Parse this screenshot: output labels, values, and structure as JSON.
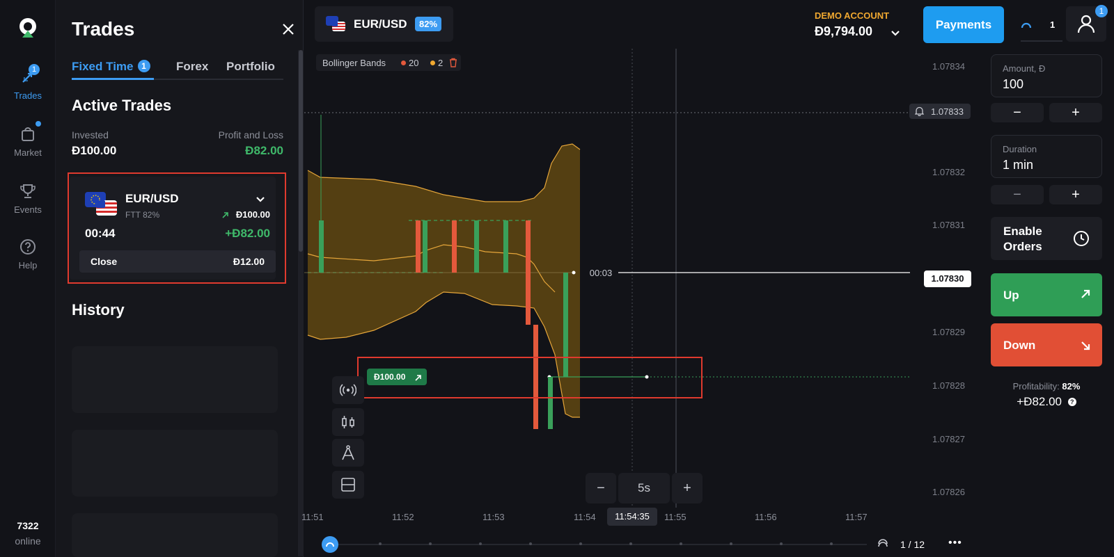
{
  "nav": {
    "trades": {
      "label": "Trades",
      "badge": "1"
    },
    "market": {
      "label": "Market"
    },
    "events": {
      "label": "Events"
    },
    "help": {
      "label": "Help"
    },
    "online_count": "7322",
    "online_label": "online"
  },
  "panel": {
    "title": "Trades",
    "tabs": [
      {
        "label": "Fixed Time",
        "badge": "1",
        "active": true
      },
      {
        "label": "Forex"
      },
      {
        "label": "Portfolio"
      }
    ],
    "active_trades_heading": "Active Trades",
    "invested_label": "Invested",
    "invested_value": "Đ100.00",
    "pnl_label": "Profit and Loss",
    "pnl_value": "Đ82.00",
    "trade": {
      "pair": "EUR/USD",
      "type": "FTT 82%",
      "amount": "Đ100.00",
      "timer": "00:44",
      "profit": "+Đ82.00",
      "close_label": "Close",
      "close_value": "Đ12.00"
    },
    "history_heading": "History"
  },
  "header": {
    "pair": "EUR/USD",
    "payout": "82%",
    "account_label": "DEMO ACCOUNT",
    "balance": "Đ9,794.00",
    "payments_label": "Payments",
    "notif_count": "1",
    "profile_badge": "1"
  },
  "indicator": {
    "name": "Bollinger Bands",
    "period": "20",
    "deviation": "2"
  },
  "chart": {
    "price_ticks": [
      "1.07834",
      "1.07833",
      "1.07832",
      "1.07831",
      "1.07830",
      "1.07829",
      "1.07828",
      "1.07827",
      "1.07826"
    ],
    "alert_price": "1.07833",
    "current_price": "1.07830",
    "countdown": "00:03",
    "trade_marker": "Đ100.00",
    "time_ticks": [
      "11:51",
      "11:52",
      "11:53",
      "11:54",
      "11:55",
      "11:56",
      "11:57"
    ],
    "cursor_time": "11:54:35",
    "timeframe": "5s",
    "zoom_minus": "−",
    "zoom_plus": "+",
    "page_indicator": "1 / 12",
    "more_label": "•••"
  },
  "order": {
    "amount_label": "Amount, Đ",
    "amount_value": "100",
    "duration_label": "Duration",
    "duration_value": "1 min",
    "minus": "−",
    "plus": "+",
    "enable_orders_line1": "Enable",
    "enable_orders_line2": "Orders",
    "up_label": "Up",
    "down_label": "Down",
    "profitability_label": "Profitability:",
    "profitability_value": "82%",
    "profit_value": "+Đ82.00"
  },
  "colors": {
    "accent": "#3d9cf2",
    "up": "#3aa05a",
    "down": "#e3593c",
    "profit": "#3fb96a",
    "band": "#7a5a12"
  }
}
